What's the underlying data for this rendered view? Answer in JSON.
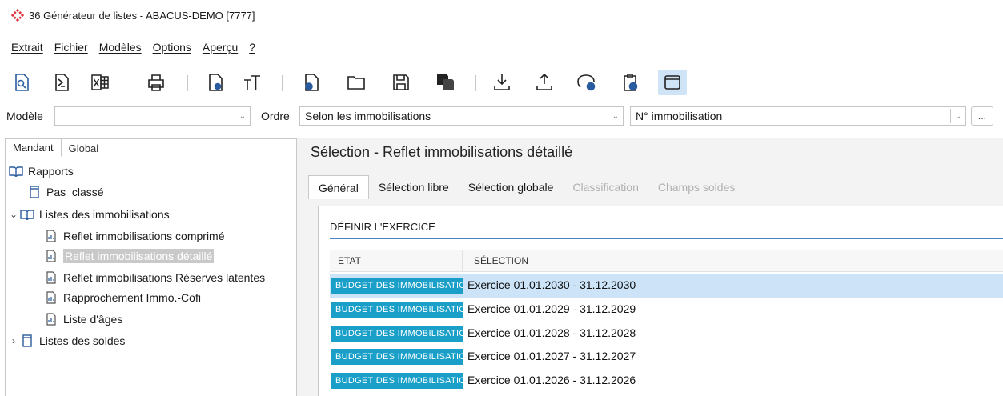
{
  "window": {
    "title": "36 Générateur de listes - ABACUS-DEMO [7777]"
  },
  "menu": [
    "Extrait",
    "Fichier",
    "Modèles",
    "Options",
    "Aperçu",
    "?"
  ],
  "toolbar": {
    "icons": [
      "preview-icon",
      "pdf-icon",
      "excel-icon",
      "print-icon",
      "settings-doc-icon",
      "font-icon",
      "new-doc-icon",
      "open-icon",
      "save-icon",
      "save-as-icon",
      "import-icon",
      "export-icon",
      "comment-add-icon",
      "clipboard-add-icon",
      "window-icon"
    ]
  },
  "filters": {
    "modele_label": "Modèle",
    "modele_value": "",
    "ordre_label": "Ordre",
    "ordre_value": "Selon les immobilisations",
    "tri_value": "N° immobilisation",
    "more_label": "..."
  },
  "left": {
    "tabs": [
      "Mandant",
      "Global"
    ],
    "tree": [
      {
        "label": "Rapports",
        "level": 0,
        "icon": "book-icon",
        "chevron": ""
      },
      {
        "label": "Pas_classé",
        "level": 1,
        "icon": "folder-icon",
        "chevron": ""
      },
      {
        "label": "Listes des immobilisations",
        "level": 0,
        "icon": "book-icon",
        "chevron": "v"
      },
      {
        "label": "Reflet immobilisations comprimé",
        "level": 2,
        "icon": "report-icon",
        "chevron": ""
      },
      {
        "label": "Reflet immobilisations détaillé",
        "level": 2,
        "icon": "report-icon",
        "chevron": "",
        "selected": true
      },
      {
        "label": "Reflet immobilisations Réserves latentes",
        "level": 2,
        "icon": "report-icon",
        "chevron": ""
      },
      {
        "label": "Rapprochement Immo.-Cofi",
        "level": 2,
        "icon": "report-icon",
        "chevron": ""
      },
      {
        "label": "Liste d'âges",
        "level": 2,
        "icon": "report-icon",
        "chevron": ""
      },
      {
        "label": "Listes des soldes",
        "level": 0,
        "icon": "folder-icon",
        "chevron": ">"
      }
    ]
  },
  "right": {
    "title": "Sélection - Reflet immobilisations détaillé",
    "tabs": [
      {
        "label": "Général",
        "state": "active"
      },
      {
        "label": "Sélection libre",
        "state": "normal"
      },
      {
        "label": "Sélection globale",
        "state": "normal"
      },
      {
        "label": "Classification",
        "state": "disabled"
      },
      {
        "label": "Champs soldes",
        "state": "disabled"
      }
    ],
    "section_heading": "DÉFINIR L'EXERCICE",
    "grid": {
      "columns": [
        "ETAT",
        "SÉLECTION"
      ],
      "rows": [
        {
          "etat": "BUDGET DES IMMOBILISATIONS",
          "selection": "Exercice 01.01.2030 - 31.12.2030",
          "selected": true
        },
        {
          "etat": "BUDGET DES IMMOBILISATIONS",
          "selection": "Exercice 01.01.2029 - 31.12.2029"
        },
        {
          "etat": "BUDGET DES IMMOBILISATIONS",
          "selection": "Exercice 01.01.2028 - 31.12.2028"
        },
        {
          "etat": "BUDGET DES IMMOBILISATIONS",
          "selection": "Exercice 01.01.2027 - 31.12.2027"
        },
        {
          "etat": "BUDGET DES IMMOBILISATIONS",
          "selection": "Exercice 01.01.2026 - 31.12.2026"
        }
      ]
    }
  },
  "colors": {
    "accent": "#1aa0c8",
    "selection": "#cde4f8",
    "logo": "#e0303a"
  }
}
